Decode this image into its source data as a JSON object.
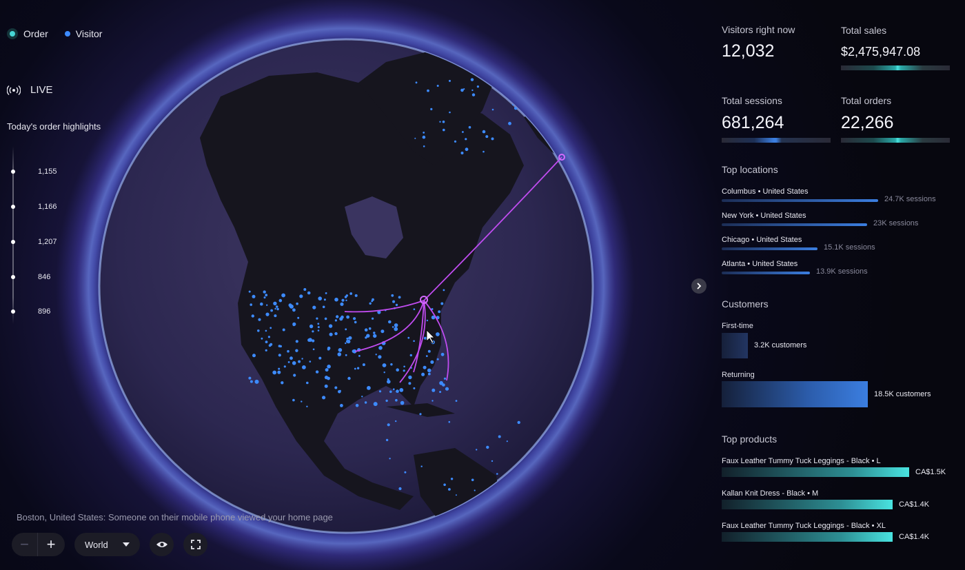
{
  "legend": {
    "order_label": "Order",
    "visitor_label": "Visitor"
  },
  "live_label": "LIVE",
  "highlights": {
    "title": "Today's order highlights",
    "items": [
      "1,155",
      "1,166",
      "1,207",
      "846",
      "896"
    ]
  },
  "event_text": "Boston, United States: Someone on their mobile phone viewed your home page",
  "controls": {
    "zoom_minus": "−",
    "zoom_plus": "+",
    "region": "World"
  },
  "stats": {
    "visitors": {
      "label": "Visitors right now",
      "value": "12,032"
    },
    "sales": {
      "label": "Total sales",
      "value": "$2,475,947.08"
    },
    "sessions": {
      "label": "Total sessions",
      "value": "681,264"
    },
    "orders": {
      "label": "Total orders",
      "value": "22,266"
    }
  },
  "top_locations": {
    "title": "Top locations",
    "items": [
      {
        "name": "Columbus • United States",
        "value": "24.7K sessions",
        "share": 1.0
      },
      {
        "name": "New York • United States",
        "value": "23K sessions",
        "share": 0.93
      },
      {
        "name": "Chicago • United States",
        "value": "15.1K sessions",
        "share": 0.61
      },
      {
        "name": "Atlanta • United States",
        "value": "13.9K sessions",
        "share": 0.56
      }
    ]
  },
  "customers": {
    "title": "Customers",
    "first_time": {
      "label": "First-time",
      "value": "3.2K customers"
    },
    "returning": {
      "label": "Returning",
      "value": "18.5K customers"
    }
  },
  "top_products": {
    "title": "Top products",
    "items": [
      {
        "name": "Faux Leather Tummy Tuck Leggings - Black • L",
        "value": "CA$1.5K",
        "share": 1.0
      },
      {
        "name": "Kallan Knit Dress - Black • M",
        "value": "CA$1.4K",
        "share": 0.91
      },
      {
        "name": "Faux Leather Tummy Tuck Leggings - Black • XL",
        "value": "CA$1.4K",
        "share": 0.91
      }
    ]
  },
  "colors": {
    "order": "#47d6d6",
    "visitor": "#3d8bff",
    "arc": "#c04cf0",
    "accent_teal": "#49e3e0",
    "accent_blue": "#3b7ee0"
  },
  "icons": [
    "live-broadcast-icon",
    "chevron-down-icon",
    "eye-icon",
    "fullscreen-icon",
    "chevron-right-icon",
    "cursor-icon"
  ]
}
